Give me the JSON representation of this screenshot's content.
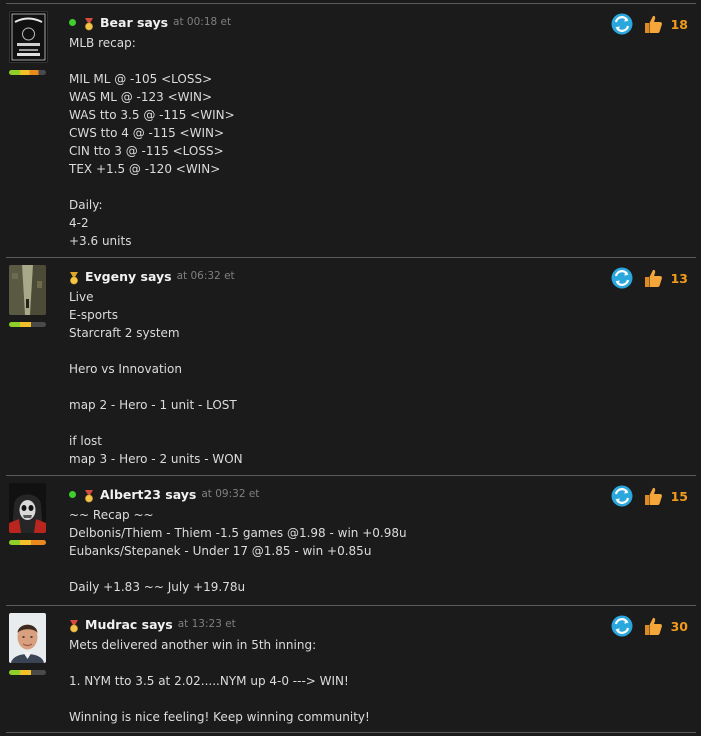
{
  "posts": [
    {
      "author": "Bear says",
      "time": "at 00:18 et",
      "online": true,
      "medal": "red",
      "likes": "18",
      "avatar_icon": "whiskey-label-avatar",
      "body": "MLB recap:\n\nMIL ML @ -105 <LOSS>\nWAS ML @ -123 <WIN>\nWAS tto 3.5 @ -115 <WIN>\nCWS tto 4 @ -115 <WIN>\nCIN tto 3 @ -115 <LOSS>\nTEX +1.5 @ -120 <WIN>\n\nDaily:\n4-2\n+3.6 units"
    },
    {
      "author": "Evgeny says",
      "time": "at 06:32 et",
      "online": false,
      "medal": "gold",
      "likes": "13",
      "avatar_icon": "alley-photo-avatar",
      "body": "Live\nE-sports\nStarcraft 2 system\n\nHero vs Innovation\n\nmap 2 - Hero - 1 unit - LOST\n\nif lost\nmap 3 - Hero - 2 units - WON"
    },
    {
      "author": "Albert23 says",
      "time": "at 09:32 et",
      "online": true,
      "medal": "red",
      "likes": "15",
      "avatar_icon": "hooded-figure-avatar",
      "body": "~~ Recap ~~\nDelbonis/Thiem - Thiem -1.5 games @1.98 - win +0.98u\nEubanks/Stepanek - Under 17 @1.85 - win +0.85u\n\nDaily +1.83 ~~ July +19.78u"
    },
    {
      "author": "Mudrac says",
      "time": "at 13:23 et",
      "online": false,
      "medal": "red",
      "likes": "30",
      "avatar_icon": "man-portrait-avatar",
      "body": "Mets delivered another win in 5th inning:\n\n1. NYM tto 3.5 at 2.02.....NYM up 4-0 ---> WIN!\n\nWinning is nice feeling! Keep winning community!"
    }
  ],
  "colors": {
    "background": "#1b1b1b",
    "like_count": "#f29a1c",
    "online": "#3dcf2e",
    "repost": "#2aa7dc"
  }
}
